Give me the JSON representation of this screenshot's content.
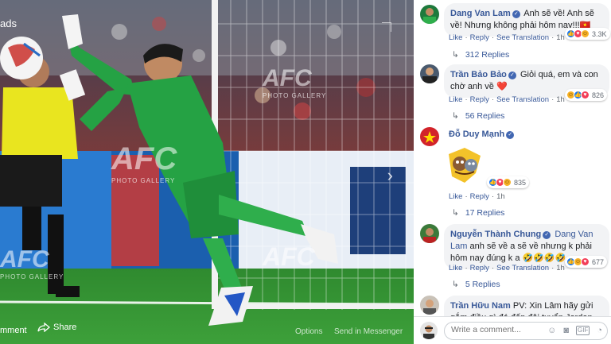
{
  "viewer": {
    "ads_label": "ads",
    "watermark_text": "AFC",
    "watermark_sub": "PHOTO GALLERY",
    "bottom_left": "mment",
    "share_label": "Share",
    "options_label": "Options",
    "messenger_label": "Send in Messenger"
  },
  "comments": [
    {
      "author": "Dang Van Lam",
      "text": "Anh sẽ về! Anh sẽ về! Nhưng không phải hôm nay!!!🇻🇳",
      "like": "Like",
      "reply": "Reply",
      "translate": "See Translation",
      "time": "1h",
      "reaction_count": "3.3K",
      "replies": "312 Replies"
    },
    {
      "author": "Trần Bảo Bảo",
      "text": "Giỏi quá, em và con chờ anh về ❤️",
      "like": "Like",
      "reply": "Reply",
      "translate": "See Translation",
      "time": "1h",
      "reaction_count": "826",
      "replies": "56 Replies"
    },
    {
      "author": "Đỗ Duy Mạnh",
      "text": "",
      "like": "Like",
      "reply": "Reply",
      "time": "1h",
      "reaction_count": "835",
      "replies": "17 Replies"
    },
    {
      "author": "Nguyễn Thành Chung",
      "mention": "Dang Van Lam",
      "text": "anh sẽ về a sẽ về nhưng k phải hôm nay đúng k a 🤣🤣🤣🤣",
      "like": "Like",
      "reply": "Reply",
      "translate": "See Translation",
      "time": "1h",
      "reaction_count": "677",
      "replies": "5 Replies"
    },
    {
      "author": "Trần Hữu Nam",
      "text": "PV: Xin Lâm hãy gửi gắm điều gì đó đến đội tuyển Jordan sau loạt sút"
    }
  ],
  "composer": {
    "placeholder": "Write a comment..."
  },
  "colors": {
    "link": "#385898",
    "bubble": "#f2f3f5",
    "pitch": "#2f8a2f",
    "kit_green": "#25a244",
    "referee": "#e9e51f"
  }
}
